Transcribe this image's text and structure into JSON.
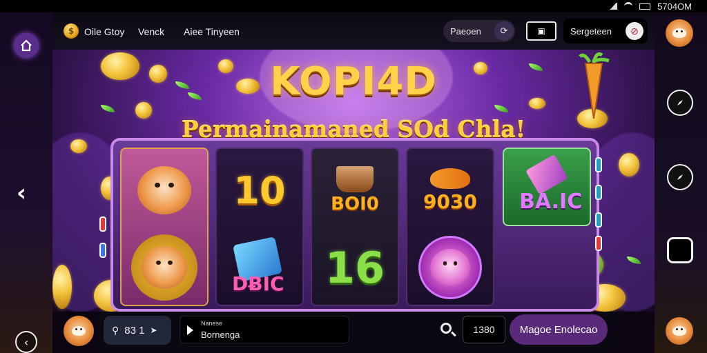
{
  "status_bar": {
    "time": "5704OM"
  },
  "top_bar": {
    "coin_icon": "coin-icon",
    "nav": [
      {
        "label": "Oile Gtoy"
      },
      {
        "label": "Venck"
      },
      {
        "label": "Aiee Tinyeen"
      }
    ],
    "profile_pill": {
      "label": "Paeoen",
      "icon": "refresh-icon"
    },
    "screen_icon": "screen-icon",
    "sound_pill": {
      "label": "Sergeteen",
      "icon": "mute-icon"
    }
  },
  "game": {
    "title": "KOPI4D",
    "subtitle": "Permainamaned SOd Chla!",
    "reels": [
      {
        "top": "pet",
        "bottom": "pet-coin"
      },
      {
        "top": "10",
        "bottom": "D⁠ɪᴄ"
      },
      {
        "top": "BOI0",
        "bottom": "16"
      },
      {
        "top": "9030",
        "bottom": "cat"
      },
      {
        "top": "BA.IC",
        "bottom": ""
      }
    ],
    "reel_texts": {
      "r2_top": "10",
      "r2_bottom": "DɃIC",
      "r3_top": "BOI0",
      "r3_bottom": "16",
      "r4_top": "9030",
      "r5_top": "BA.IC"
    }
  },
  "bottom_bar": {
    "balance": "83 1",
    "info_line1": "Nanese",
    "info_line2": "Bornenga",
    "bet": "1380",
    "spin_label": "Magoe Enolecao"
  },
  "left_rail": {
    "home_icon": "home-icon",
    "prev_icon": "chevron-left-icon",
    "back_icon": "back-icon"
  },
  "right_rail": {
    "icons": [
      "compass-icon",
      "compass-icon",
      "square-icon"
    ]
  }
}
